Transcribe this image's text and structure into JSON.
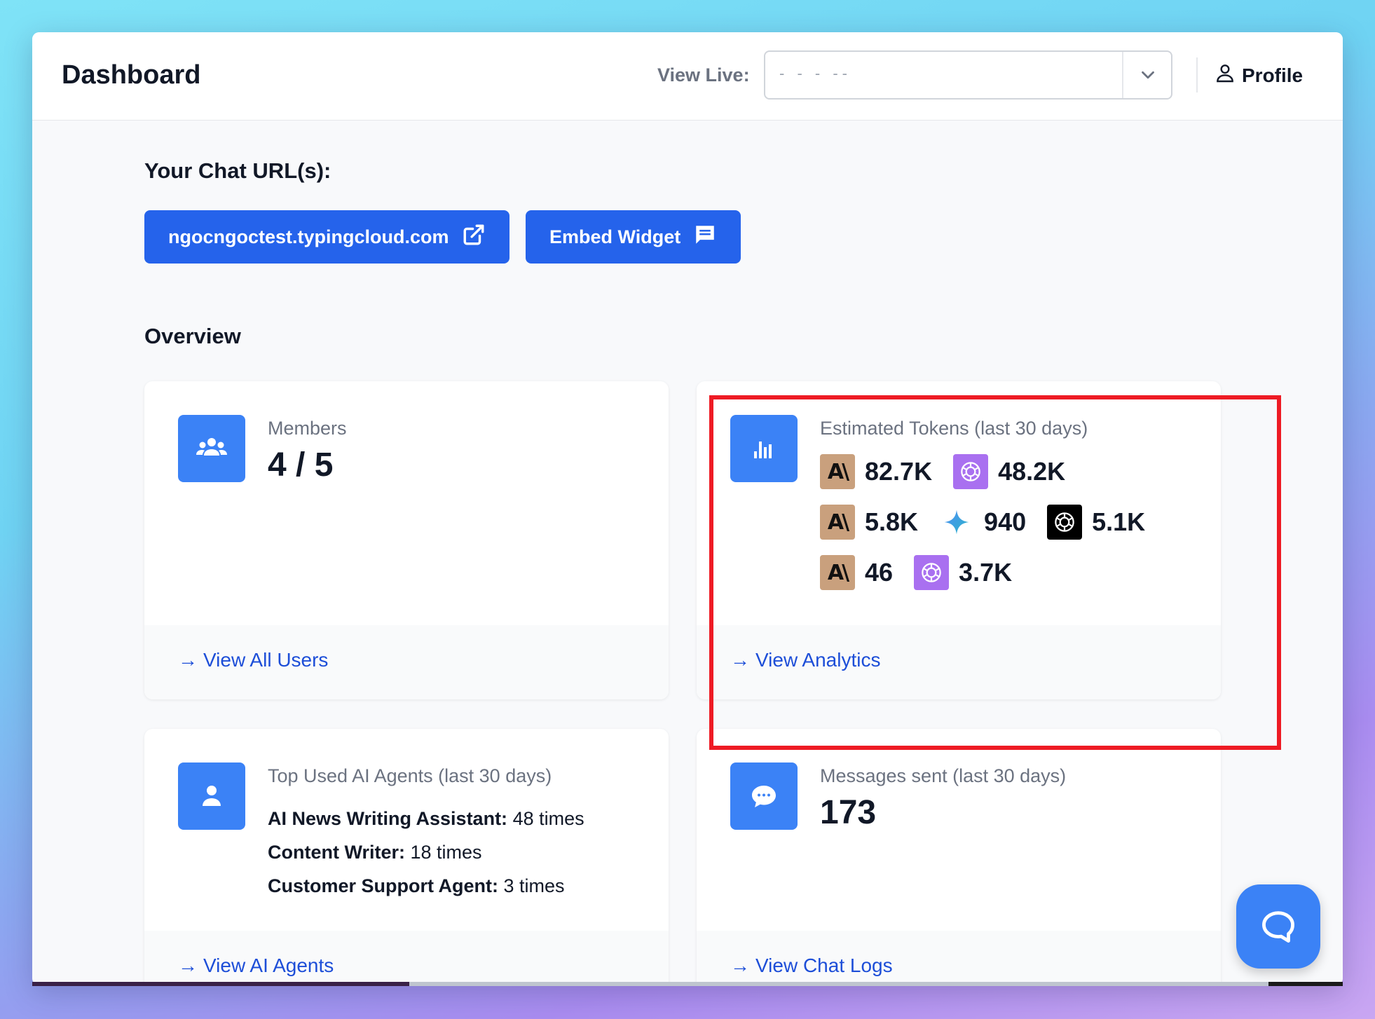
{
  "header": {
    "title": "Dashboard",
    "view_live_label": "View Live:",
    "view_live_value": "- - - --",
    "profile_label": "Profile"
  },
  "chat_urls": {
    "heading": "Your Chat URL(s):",
    "url_button": "ngocngoctest.typingcloud.com",
    "embed_button": "Embed Widget"
  },
  "overview": {
    "heading": "Overview",
    "members": {
      "label": "Members",
      "value": "4 / 5",
      "link": "View All Users"
    },
    "tokens": {
      "label": "Estimated Tokens (last 30 days)",
      "rows": [
        [
          {
            "logo": "anthropic-logo",
            "value": "82.7K"
          },
          {
            "logo": "openai-purple-logo",
            "value": "48.2K"
          }
        ],
        [
          {
            "logo": "anthropic-logo",
            "value": "5.8K"
          },
          {
            "logo": "gemini-logo",
            "value": "940"
          },
          {
            "logo": "openai-black-logo",
            "value": "5.1K"
          }
        ],
        [
          {
            "logo": "anthropic-logo",
            "value": "46"
          },
          {
            "logo": "openai-purple-logo",
            "value": "3.7K"
          }
        ]
      ],
      "link": "View Analytics"
    },
    "agents": {
      "label": "Top Used AI Agents (last 30 days)",
      "items": [
        {
          "name": "AI News Writing Assistant:",
          "count": "48 times"
        },
        {
          "name": "Content Writer:",
          "count": "18 times"
        },
        {
          "name": "Customer Support Agent:",
          "count": "3 times"
        }
      ],
      "link": "View AI Agents"
    },
    "messages": {
      "label": "Messages sent (last 30 days)",
      "value": "173",
      "link": "View Chat Logs"
    }
  },
  "colors": {
    "primary": "#2563eb",
    "icon_bg": "#3b82f6",
    "link": "#1d4ed8",
    "highlight": "#ee1b24"
  }
}
